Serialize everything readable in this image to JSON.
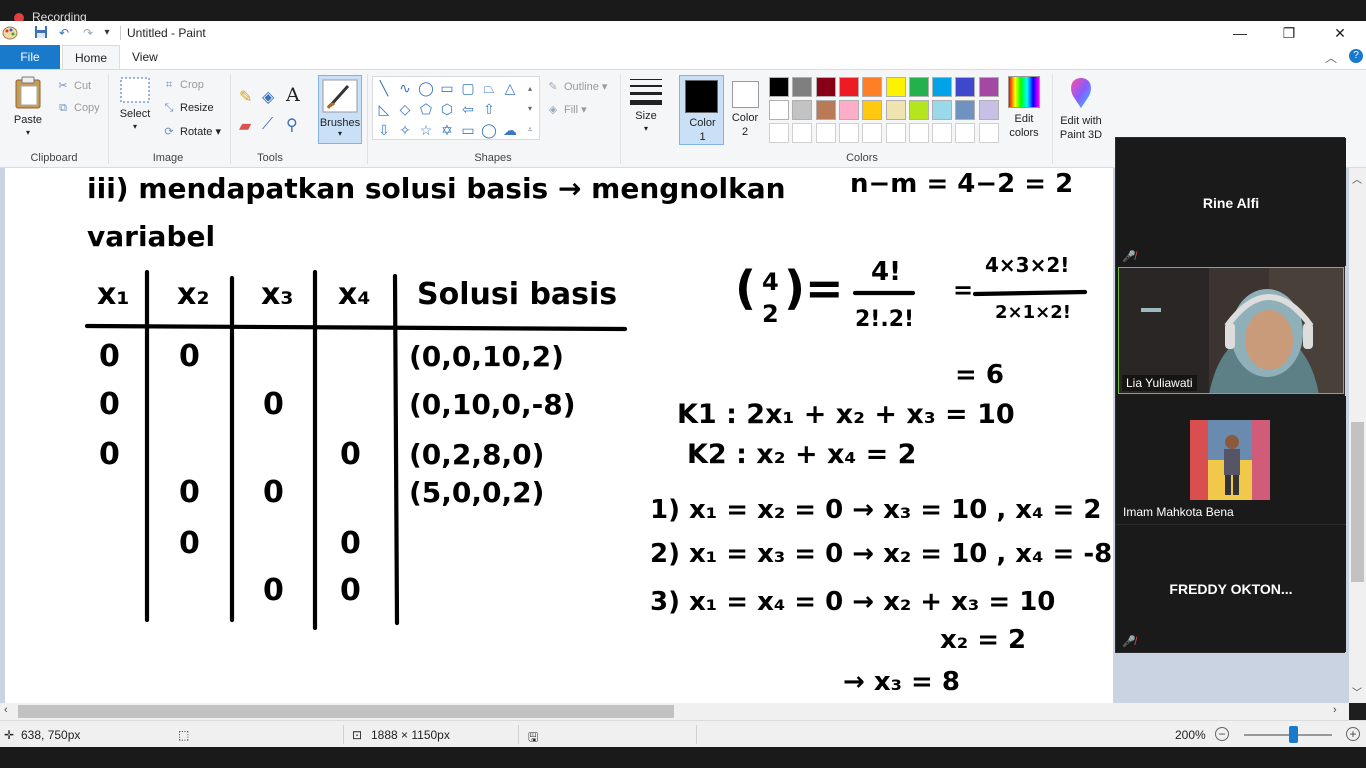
{
  "recording": {
    "label": "Recording"
  },
  "titlebar": {
    "title": "Untitled - Paint",
    "quick_access": [
      "save-icon",
      "undo-icon",
      "redo-icon",
      "customize-icon"
    ],
    "window_controls": [
      "minimize",
      "restore",
      "close"
    ]
  },
  "tabs": {
    "file": "File",
    "home": "Home",
    "view": "View",
    "active": "Home"
  },
  "ribbon": {
    "clipboard": {
      "paste": "Paste",
      "cut": "Cut",
      "copy": "Copy",
      "label": "Clipboard"
    },
    "image": {
      "select": "Select",
      "crop": "Crop",
      "resize": "Resize",
      "rotate": "Rotate",
      "label": "Image"
    },
    "tools": {
      "label": "Tools",
      "items": [
        "pencil-icon",
        "fill-icon",
        "text-icon",
        "eraser-icon",
        "color-picker-icon",
        "magnifier-icon"
      ]
    },
    "brushes": {
      "label": "Brushes"
    },
    "shapes": {
      "outline": "Outline",
      "fill": "Fill",
      "label": "Shapes"
    },
    "size": {
      "label": "Size"
    },
    "colors": {
      "color1": "Color\n1",
      "color1_line1": "Color",
      "color1_line2": "1",
      "color2_line1": "Color",
      "color2_line2": "2",
      "color1_value": "#000000",
      "color2_value": "#ffffff",
      "edit_colors_line1": "Edit",
      "edit_colors_line2": "colors",
      "edit_3d_line1": "Edit with",
      "edit_3d_line2": "Paint 3D",
      "label": "Colors",
      "palette_row1": [
        "#000000",
        "#7f7f7f",
        "#880015",
        "#ed1c24",
        "#ff7f27",
        "#fff200",
        "#22b14c",
        "#00a2e8",
        "#3f48cc",
        "#a349a4"
      ],
      "palette_row2": [
        "#ffffff",
        "#c3c3c3",
        "#b97a57",
        "#ffaec9",
        "#ffc90e",
        "#efe4b0",
        "#b5e61d",
        "#99d9ea",
        "#7092be",
        "#c8bfe7"
      ]
    }
  },
  "canvas_content": {
    "heading_line1": "iii) mendapatkan solusi basis → mengnolkan",
    "heading_line2": "variabel",
    "top_right_calc": "n−m = 4−2 = 2",
    "table": {
      "headers": [
        "x₁",
        "x₂",
        "x₃",
        "x₄",
        "Solusi basis"
      ],
      "rows": [
        [
          "0",
          "0",
          "",
          "",
          "(0,0,10,2)"
        ],
        [
          "0",
          "",
          "0",
          "",
          "(0,10,0,-8)"
        ],
        [
          "0",
          "",
          "",
          "0",
          "(0,2,8,0)"
        ],
        [
          "",
          "0",
          "0",
          "",
          "(5,0,0,2)"
        ],
        [
          "",
          "0",
          "",
          "0",
          ""
        ],
        [
          "",
          "",
          "0",
          "0",
          ""
        ]
      ]
    },
    "combination": {
      "binom_top": "4",
      "binom_bottom": "2",
      "frac1_top": "4!",
      "frac1_bottom": "2!.2!",
      "frac2_top": "4×3×2!",
      "frac2_bottom": "2×1×2!",
      "result": "= 6"
    },
    "constraints": {
      "k1": "K1 : 2x₁ + x₂ + x₃ = 10",
      "k2": "K2 :  x₂  + x₄ = 2"
    },
    "solutions": [
      "1) x₁ = x₂ = 0  →  x₃ = 10 , x₄ = 2",
      "2) x₁ = x₃ = 0  →  x₂ = 10 ,  x₄ = -8",
      "3) x₁ = x₄ = 0  →  x₂ + x₃ = 10",
      "x₂ = 2",
      "→ x₃ = 8"
    ]
  },
  "zoom_panel": {
    "participants": [
      {
        "name": "Rine Alfi",
        "muted": true,
        "video": false
      },
      {
        "name": "Lia Yuliawati",
        "muted": false,
        "video": true,
        "active_speaker": true
      },
      {
        "name": "Imam Mahkota Bena",
        "muted": false,
        "video": true
      },
      {
        "name": "FREDDY  OKTON...",
        "muted": true,
        "video": false
      }
    ]
  },
  "statusbar": {
    "cursor_pos": "638, 750px",
    "image_size": "1888 × 1150px",
    "zoom": "200%"
  }
}
